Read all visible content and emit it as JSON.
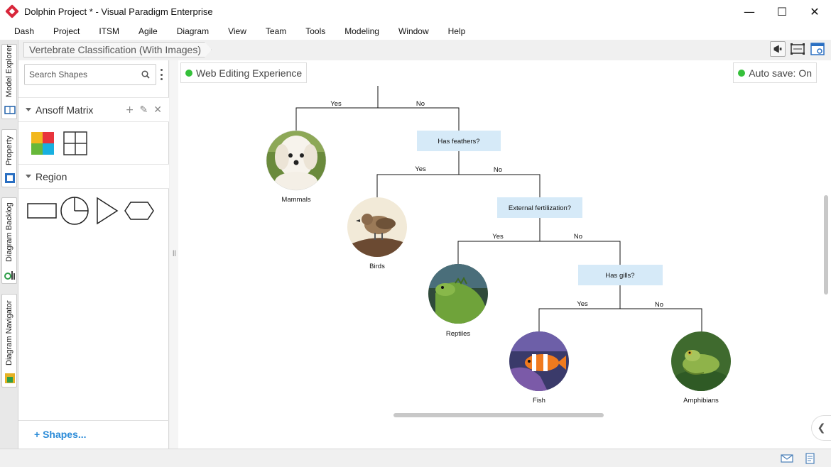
{
  "window": {
    "title": "Dolphin Project * - Visual Paradigm Enterprise",
    "minimize": "—",
    "maximize": "☐",
    "close": "✕"
  },
  "menu": [
    "Dash",
    "Project",
    "ITSM",
    "Agile",
    "Diagram",
    "View",
    "Team",
    "Tools",
    "Modeling",
    "Window",
    "Help"
  ],
  "side_tabs": [
    "Model Explorer",
    "Property",
    "Diagram Backlog",
    "Diagram Navigator"
  ],
  "breadcrumb": "Vertebrate Classification (With Images)",
  "sidebar": {
    "search_placeholder": "Search Shapes",
    "sections": [
      {
        "title": "Ansoff Matrix"
      },
      {
        "title": "Region"
      }
    ],
    "shapes_link": "+ Shapes..."
  },
  "canvas": {
    "badge_left": "Web Editing Experience",
    "badge_right": "Auto save: On",
    "status_color": "#35c03a"
  },
  "diagram": {
    "questions": [
      "Has feathers?",
      "External fertilization?",
      "Has gills?"
    ],
    "answers": [
      "Yes",
      "No"
    ],
    "classes": [
      "Mammals",
      "Birds",
      "Reptiles",
      "Fish",
      "Amphibians"
    ],
    "decision_fill": "#d6eaf8"
  }
}
